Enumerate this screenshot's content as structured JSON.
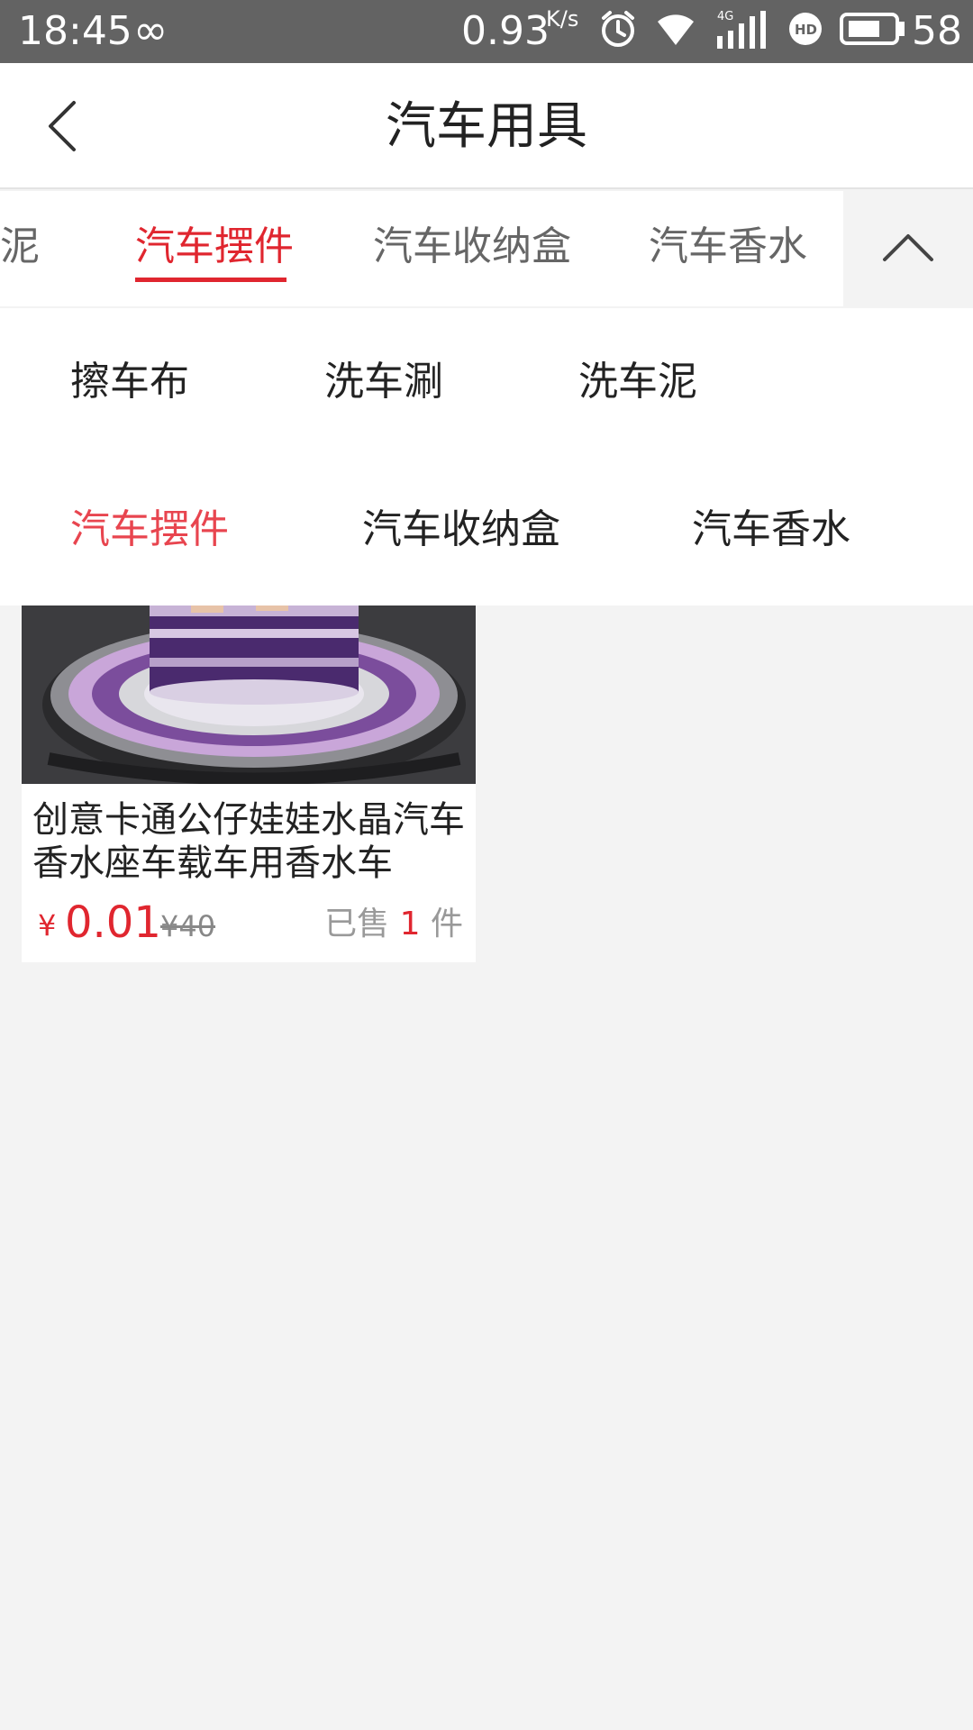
{
  "status_bar": {
    "time": "18:45",
    "infinity": "∞",
    "net_speed": "0.93",
    "net_unit": "K/s",
    "battery_level": "58",
    "icons": [
      "alarm-icon",
      "wifi-icon",
      "signal-4g-icon",
      "hd-icon",
      "battery-icon"
    ]
  },
  "header": {
    "title": "汽车用具",
    "back_icon": "chevron-left-icon"
  },
  "tabs": [
    {
      "label": "车泥",
      "active": false
    },
    {
      "label": "汽车摆件",
      "active": true
    },
    {
      "label": "汽车收纳盒",
      "active": false
    },
    {
      "label": "汽车香水",
      "active": false
    }
  ],
  "collapse_icon": "chevron-up-icon",
  "dropdown": {
    "items": [
      {
        "label": "擦车布",
        "active": false
      },
      {
        "label": "洗车涮",
        "active": false
      },
      {
        "label": "洗车泥",
        "active": false
      },
      {
        "label": "汽车摆件",
        "active": true
      },
      {
        "label": "汽车收纳盒",
        "active": false
      },
      {
        "label": "汽车香水",
        "active": false
      }
    ]
  },
  "product": {
    "title": "创意卡通公仔娃娃水晶汽车香水座车载车用香水车",
    "currency": "¥",
    "price": "0.01",
    "original_price": "¥40",
    "sold_prefix": "已售",
    "sold_count": "1",
    "sold_suffix": "件"
  },
  "colors": {
    "accent": "#e0262f",
    "status_bar": "#636363",
    "background": "#f3f3f3"
  }
}
